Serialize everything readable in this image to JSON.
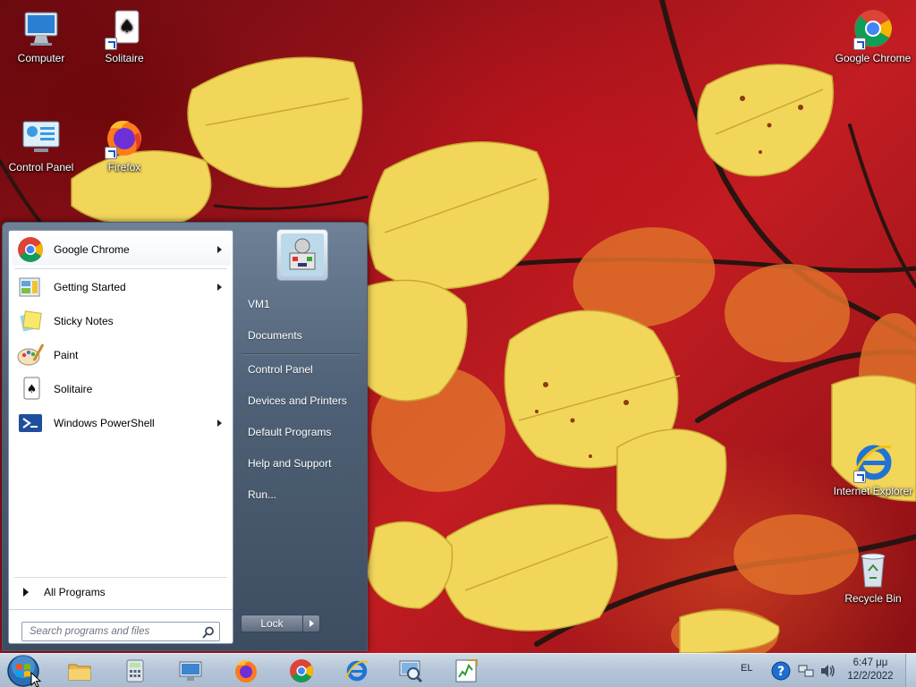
{
  "desktop": {
    "icons": [
      {
        "label": "Computer",
        "icon": "computer-icon"
      },
      {
        "label": "Solitaire",
        "icon": "solitaire-icon"
      },
      {
        "label": "Google Chrome",
        "icon": "chrome-icon"
      },
      {
        "label": "Control Panel",
        "icon": "control-panel-icon"
      },
      {
        "label": "Firefox",
        "icon": "firefox-icon"
      },
      {
        "label": "Internet Explorer",
        "icon": "internet-explorer-icon"
      },
      {
        "label": "Recycle Bin",
        "icon": "recycle-bin-icon"
      }
    ]
  },
  "start_menu": {
    "programs": [
      {
        "label": "Google Chrome",
        "icon": "chrome-icon",
        "has_submenu": true
      },
      {
        "label": "Getting Started",
        "icon": "getting-started-icon",
        "has_submenu": true
      },
      {
        "label": "Sticky Notes",
        "icon": "sticky-notes-icon",
        "has_submenu": false
      },
      {
        "label": "Paint",
        "icon": "paint-icon",
        "has_submenu": false
      },
      {
        "label": "Solitaire",
        "icon": "solitaire-icon",
        "has_submenu": false
      },
      {
        "label": "Windows PowerShell",
        "icon": "powershell-icon",
        "has_submenu": true
      }
    ],
    "all_programs_label": "All Programs",
    "search_placeholder": "Search programs and files",
    "right_items": [
      {
        "label": "VM1"
      },
      {
        "label": "Documents"
      },
      {
        "label": "Control Panel"
      },
      {
        "label": "Devices and Printers"
      },
      {
        "label": "Default Programs"
      },
      {
        "label": "Help and Support"
      },
      {
        "label": "Run..."
      }
    ],
    "lock_label": "Lock"
  },
  "taskbar": {
    "pinned": [
      {
        "name": "windows-explorer",
        "icon": "folder-icon"
      },
      {
        "name": "calculator",
        "icon": "calculator-icon"
      },
      {
        "name": "remote-desktop",
        "icon": "remote-desktop-icon"
      },
      {
        "name": "firefox",
        "icon": "firefox-icon"
      },
      {
        "name": "google-chrome",
        "icon": "chrome-icon"
      },
      {
        "name": "internet-explorer",
        "icon": "internet-explorer-icon"
      },
      {
        "name": "magnifier",
        "icon": "magnifier-icon"
      },
      {
        "name": "resource-monitor",
        "icon": "monitor-icon"
      }
    ],
    "tray": {
      "language": "EL",
      "time": "6:47 μμ",
      "date": "12/2/2022"
    }
  },
  "colors": {
    "taskbar": "#b6c6d8",
    "start_right_pane": "#4f6176",
    "wallpaper_red": "#a3141b",
    "leaf_yellow": "#f2d65a"
  }
}
